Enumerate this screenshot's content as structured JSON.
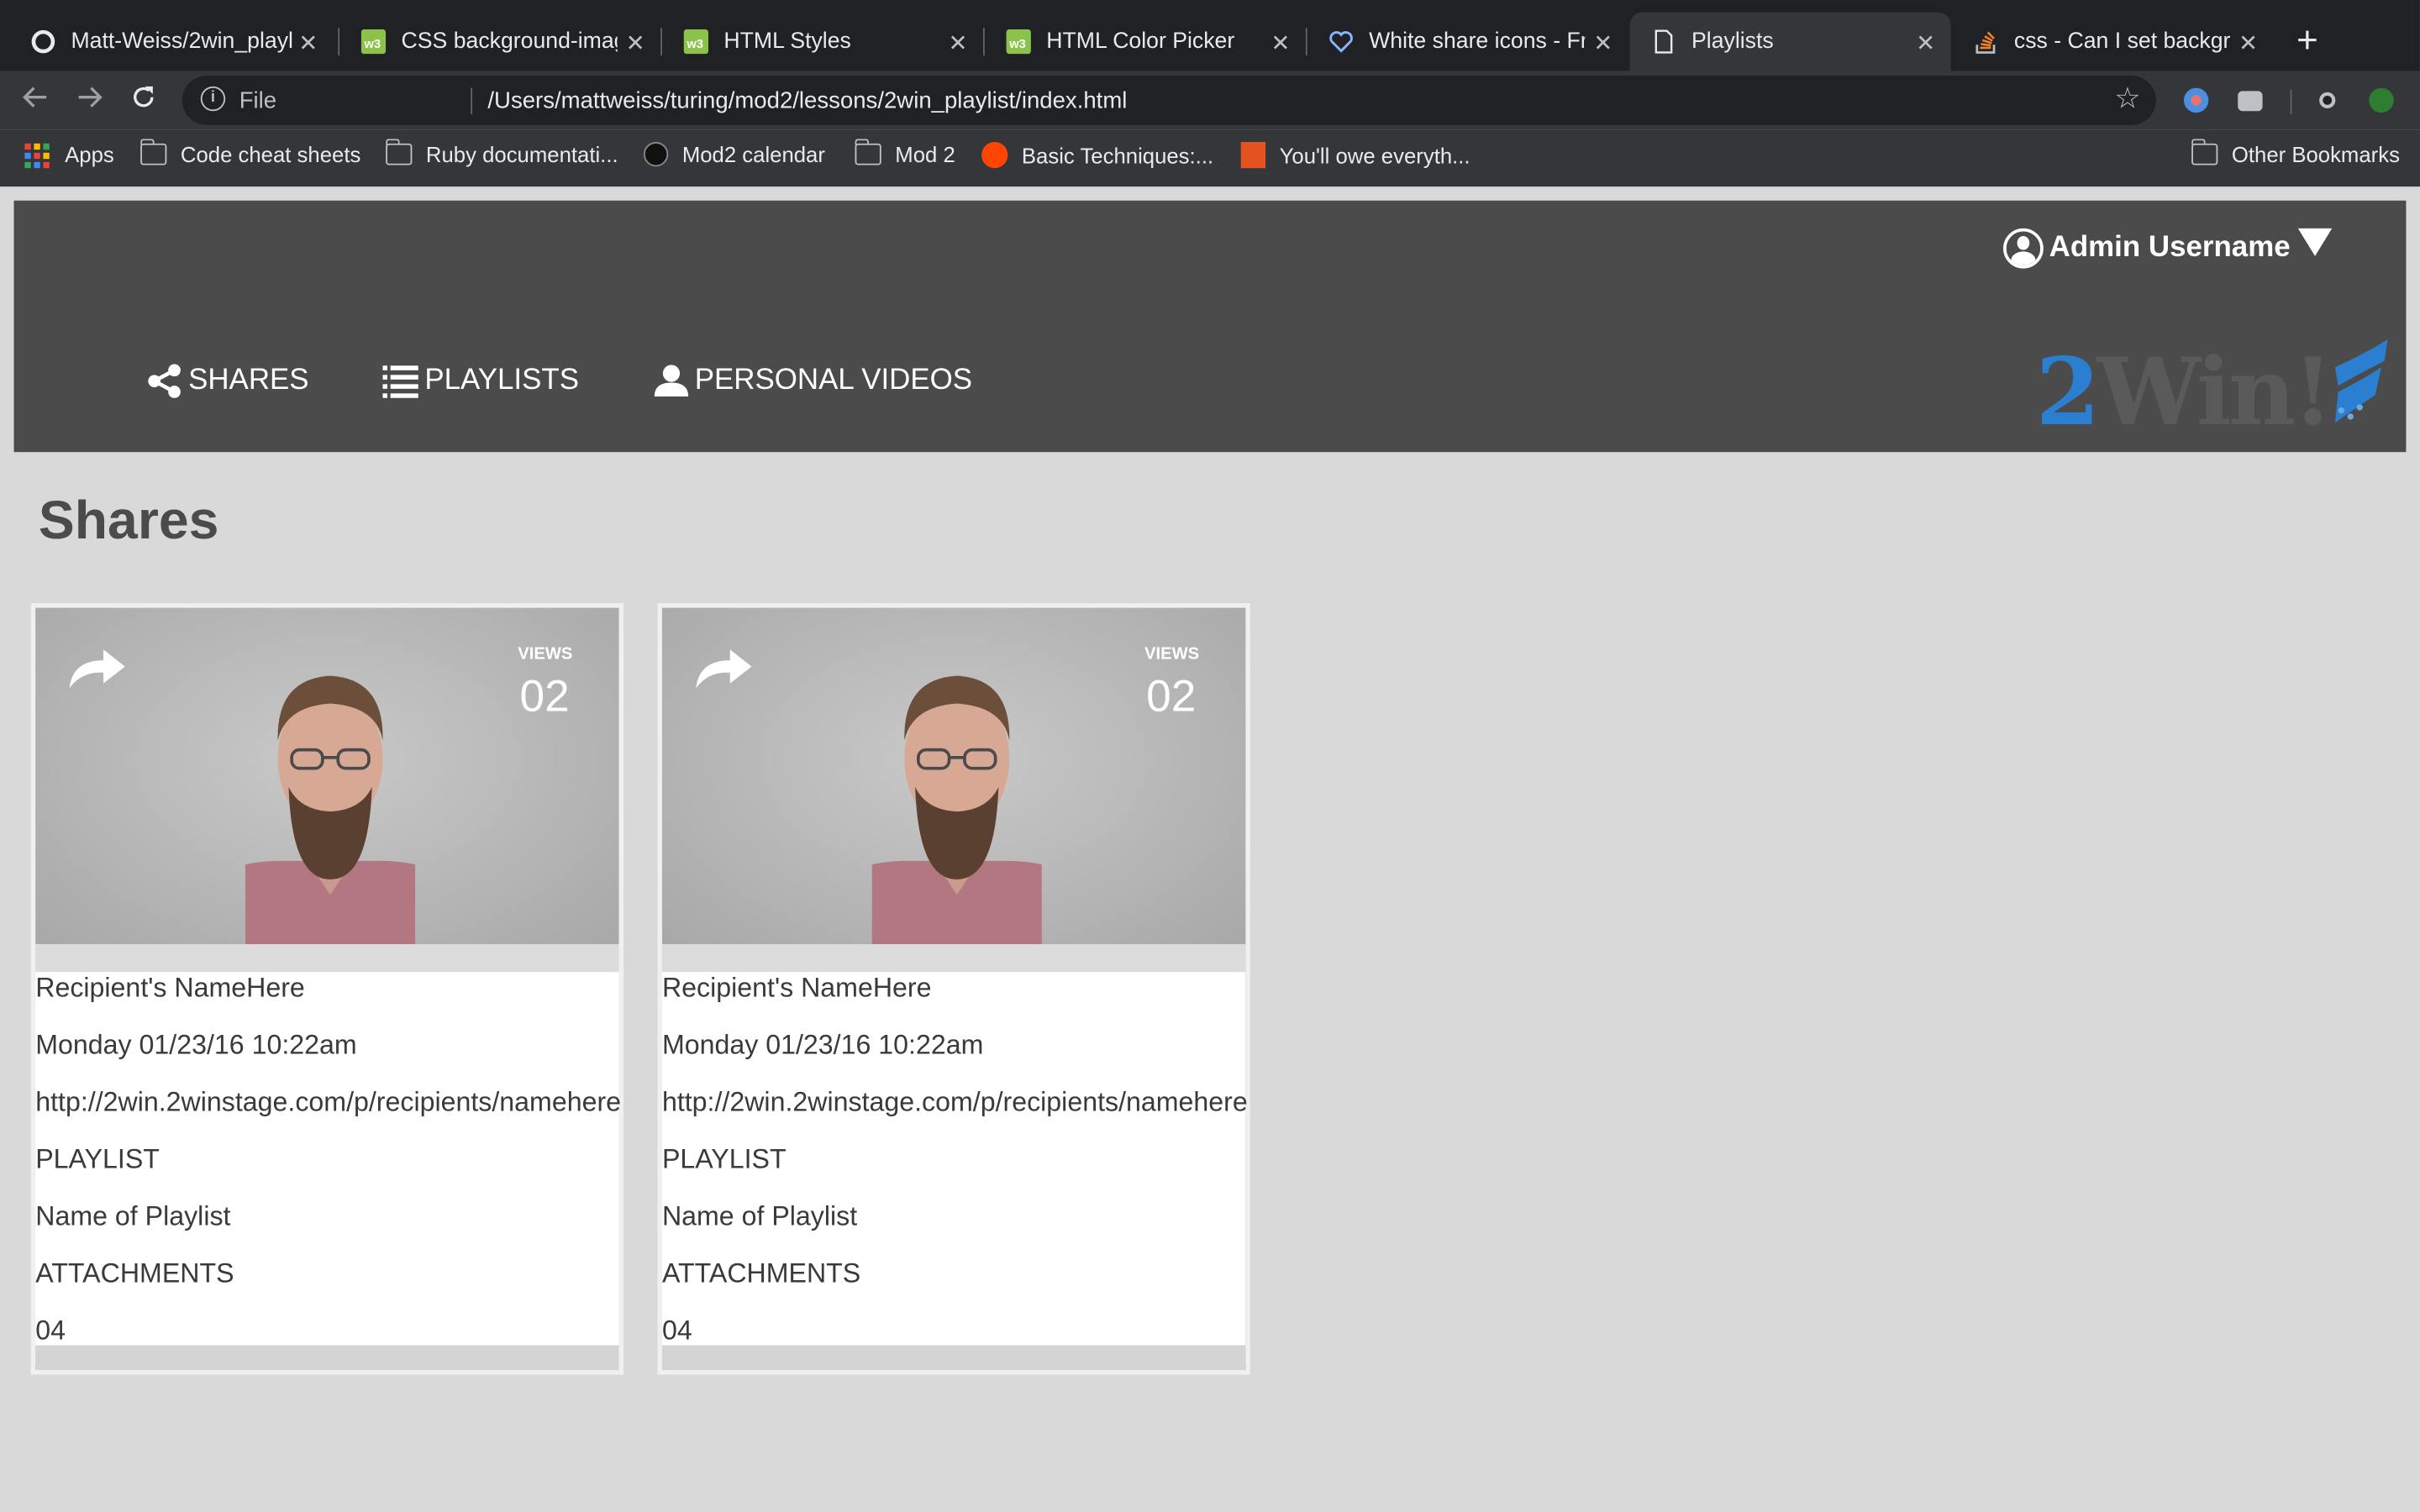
{
  "browser": {
    "tabs": [
      {
        "title": "Matt-Weiss/2win_playl",
        "icon": "github-icon"
      },
      {
        "title": "CSS background-imag",
        "icon": "w3schools-icon"
      },
      {
        "title": "HTML Styles",
        "icon": "w3schools-icon"
      },
      {
        "title": "HTML Color Picker",
        "icon": "w3schools-icon"
      },
      {
        "title": "White share icons - Fr",
        "icon": "heart-icon"
      },
      {
        "title": "Playlists",
        "icon": "page-icon",
        "active": true
      },
      {
        "title": "css - Can I set backgr",
        "icon": "stackoverflow-icon"
      }
    ],
    "omnibox": {
      "scheme": "File",
      "url": "/Users/mattweiss/turing/mod2/lessons/2win_playlist/index.html"
    },
    "bookmarks": [
      {
        "label": "Apps",
        "icon": "apps-icon"
      },
      {
        "label": "Code cheat sheets",
        "icon": "folder-icon"
      },
      {
        "label": "Ruby documentati...",
        "icon": "folder-icon"
      },
      {
        "label": "Mod2 calendar",
        "icon": "turing-icon"
      },
      {
        "label": "Mod 2",
        "icon": "folder-icon"
      },
      {
        "label": "Basic Techniques:...",
        "icon": "reddit-icon"
      },
      {
        "label": "You'll owe everyth...",
        "icon": "tumblr-icon"
      }
    ],
    "other_bookmarks": "Other Bookmarks"
  },
  "header": {
    "username": "Admin Username",
    "nav": [
      {
        "label": "SHARES",
        "icon": "share-icon"
      },
      {
        "label": "PLAYLISTS",
        "icon": "list-icon"
      },
      {
        "label": "PERSONAL VIDEOS",
        "icon": "person-icon"
      }
    ],
    "logo": {
      "part1": "2",
      "part2": "Win!"
    }
  },
  "main": {
    "title": "Shares",
    "cards": [
      {
        "views_label": "VIEWS",
        "views": "02",
        "recipient": "Recipient's NameHere",
        "date": "Monday 01/23/16 10:22am",
        "url": "http://2win.2winstage.com/p/recipients/namehere",
        "playlist_label": "PLAYLIST",
        "playlist_name": "Name of Playlist",
        "attachments_label": "ATTACHMENTS",
        "attachments": "04"
      },
      {
        "views_label": "VIEWS",
        "views": "02",
        "recipient": "Recipient's NameHere",
        "date": "Monday 01/23/16 10:22am",
        "url": "http://2win.2winstage.com/p/recipients/namehere",
        "playlist_label": "PLAYLIST",
        "playlist_name": "Name of Playlist",
        "attachments_label": "ATTACHMENTS",
        "attachments": "04"
      }
    ]
  },
  "colors": {
    "header_bg": "#4b4b4b",
    "page_bg": "#d9d9d9",
    "logo_blue": "#2a7fd0"
  }
}
